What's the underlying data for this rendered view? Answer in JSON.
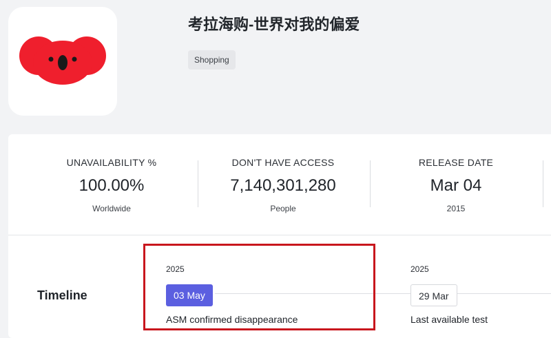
{
  "app": {
    "title": "考拉海购-世界对我的偏爱",
    "category": "Shopping",
    "icon": "koala-logo-icon",
    "brand_color": "#ef1f2d"
  },
  "stats": [
    {
      "label": "UNAVAILABILITY %",
      "value": "100.00%",
      "sub": "Worldwide"
    },
    {
      "label": "DON'T HAVE ACCESS",
      "value": "7,140,301,280",
      "sub": "People"
    },
    {
      "label": "RELEASE DATE",
      "value": "Mar 04",
      "sub": "2015"
    }
  ],
  "timeline": {
    "label": "Timeline",
    "accent_color": "#5b5fe0",
    "highlight_color": "#c8161d",
    "events": [
      {
        "year": "2025",
        "date": "03 May",
        "description": "ASM confirmed disappearance",
        "active": true
      },
      {
        "year": "2025",
        "date": "29 Mar",
        "description": "Last available test",
        "active": false
      }
    ]
  }
}
